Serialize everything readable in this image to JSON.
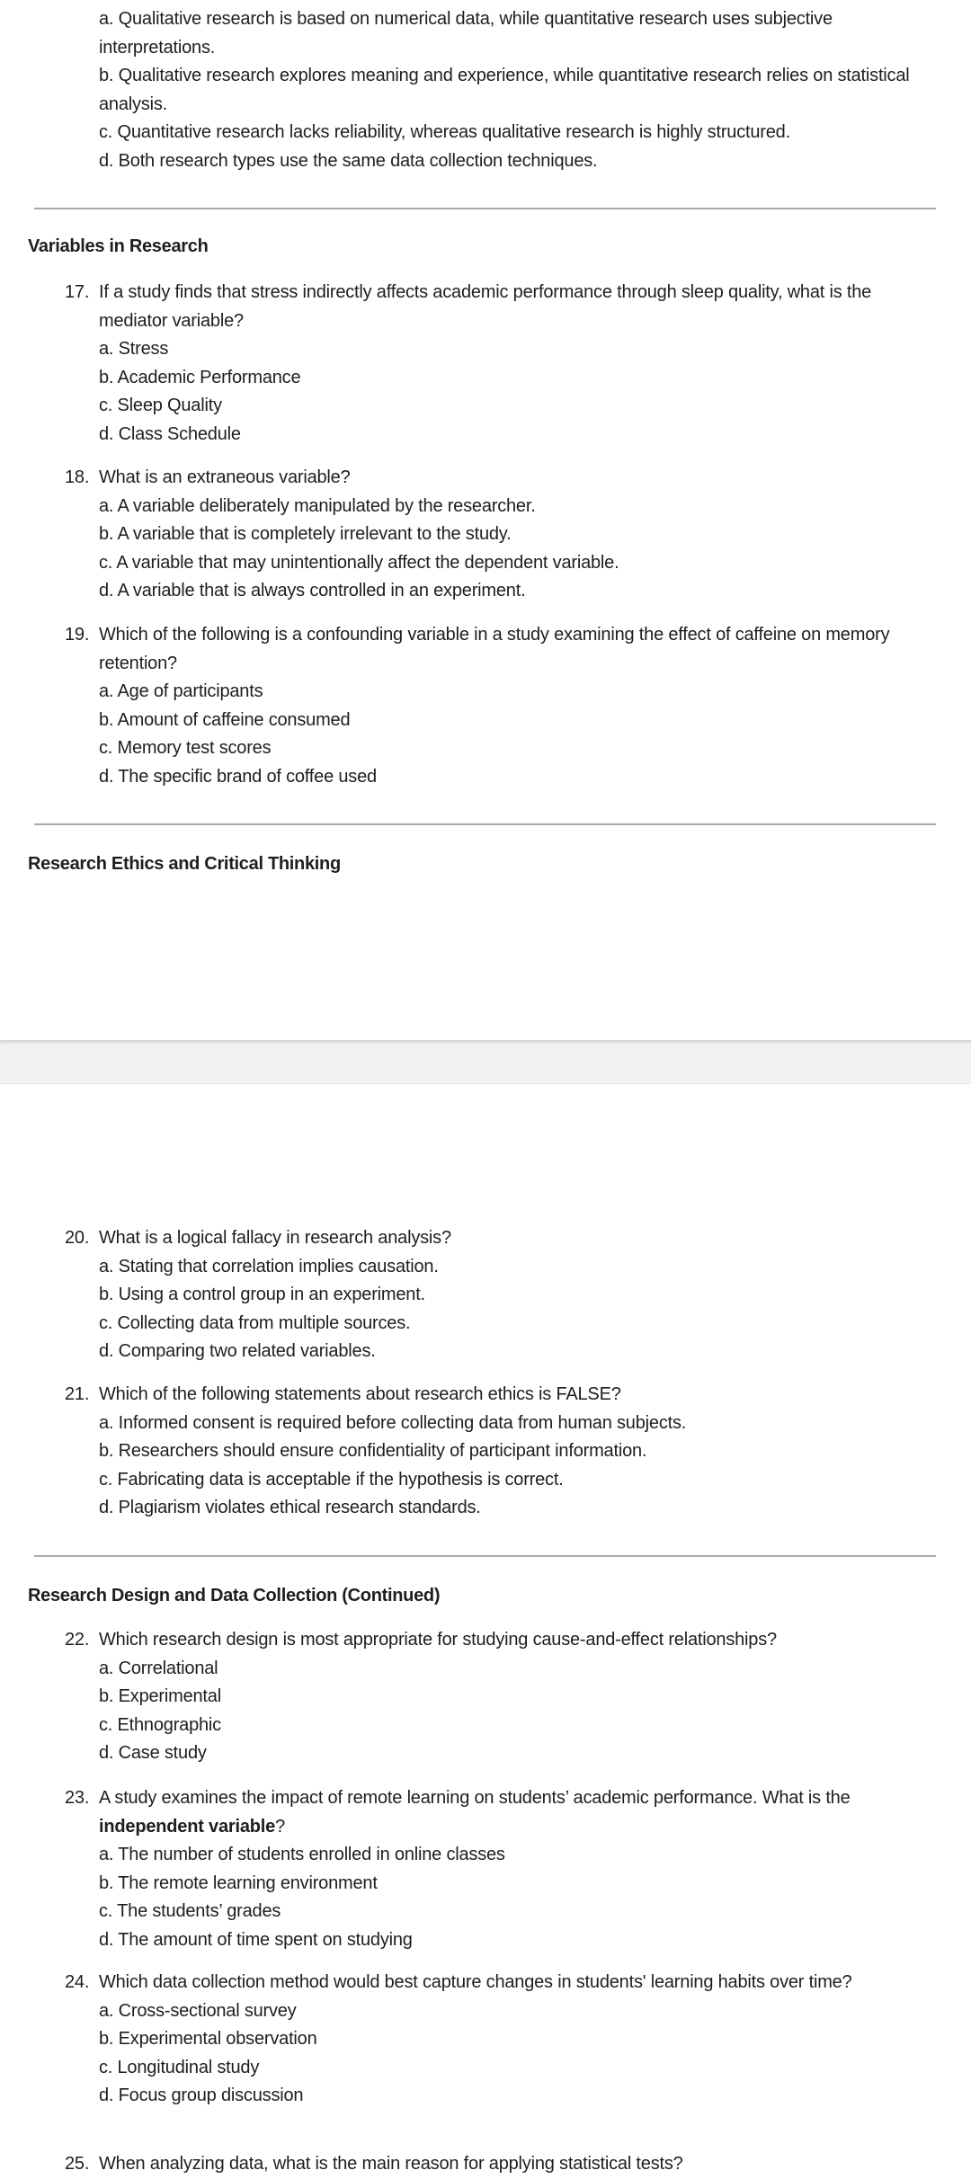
{
  "fragment_options": [
    "a. Qualitative research is based on numerical data, while quantitative research uses subjective interpretations.",
    "b. Qualitative research explores meaning and experience, while quantitative research relies on statistical analysis.",
    "c. Quantitative research lacks reliability, whereas qualitative research is highly structured.",
    "d. Both research types use the same data collection techniques."
  ],
  "headings": {
    "variables": "Variables in Research",
    "ethics": "Research Ethics and Critical Thinking",
    "design": "Research Design and Data Collection (Continued)"
  },
  "questions": [
    {
      "number": "17.",
      "text": "If a study finds that stress indirectly affects academic performance through sleep quality, what is the mediator variable?",
      "options": [
        "a. Stress",
        "b. Academic Performance",
        "c. Sleep Quality",
        "d. Class Schedule"
      ]
    },
    {
      "number": "18.",
      "text": "What is an extraneous variable?",
      "options": [
        "a. A variable deliberately manipulated by the researcher.",
        "b. A variable that is completely irrelevant to the study.",
        "c. A variable that may unintentionally affect the dependent variable.",
        "d. A variable that is always controlled in an experiment."
      ]
    },
    {
      "number": "19.",
      "text": "Which of the following is a confounding variable in a study examining the effect of caffeine on memory retention?",
      "options": [
        "a. Age of participants",
        "b. Amount of caffeine consumed",
        "c. Memory test scores",
        "d. The specific brand of coffee used"
      ]
    },
    {
      "number": "20.",
      "text": "What is a logical fallacy in research analysis?",
      "options": [
        "a. Stating that correlation implies causation.",
        "b. Using a control group in an experiment.",
        "c. Collecting data from multiple sources.",
        "d. Comparing two related variables."
      ]
    },
    {
      "number": "21.",
      "text": "Which of the following statements about research ethics is FALSE?",
      "options": [
        "a. Informed consent is required before collecting data from human subjects.",
        "b. Researchers should ensure confidentiality of participant information.",
        "c. Fabricating data is acceptable if the hypothesis is correct.",
        "d. Plagiarism violates ethical research standards."
      ]
    },
    {
      "number": "22.",
      "text": "Which research design is most appropriate for studying cause-and-effect relationships?",
      "options": [
        "a. Correlational",
        "b. Experimental",
        "c. Ethnographic",
        "d. Case study"
      ]
    },
    {
      "number": "23.",
      "text": "A study examines the impact of remote learning on students’ academic performance. What is the ",
      "bold": "independent variable",
      "text_after": "?",
      "options": [
        "a. The number of students enrolled in online classes",
        "b. The remote learning environment",
        "c. The students’ grades",
        "d. The amount of time spent on studying"
      ]
    },
    {
      "number": "24.",
      "text": "Which data collection method would best capture changes in students' learning habits over time?",
      "options": [
        "a. Cross-sectional survey",
        "b. Experimental observation",
        "c. Longitudinal study",
        "d. Focus group discussion"
      ]
    },
    {
      "number": "25.",
      "text": "When analyzing data, what is the main reason for applying statistical tests?",
      "options": []
    }
  ]
}
